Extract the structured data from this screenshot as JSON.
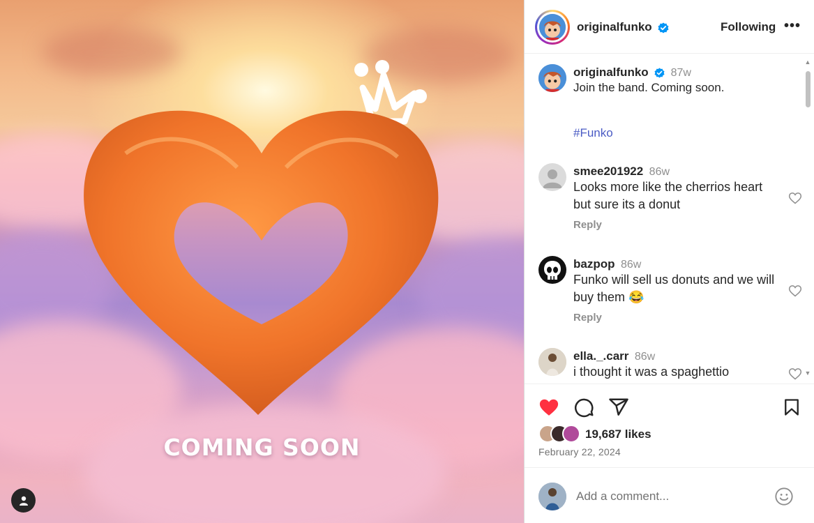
{
  "media": {
    "overlay_text": "COMING SOON",
    "tag_icon": "person-icon"
  },
  "header": {
    "username": "originalfunko",
    "verified_icon": "verified-badge-icon",
    "follow_state": "Following",
    "more_label": "•••"
  },
  "caption": {
    "username": "originalfunko",
    "time": "87w",
    "text": "Join the band. Coming soon.",
    "hashtag": "#Funko"
  },
  "comments": [
    {
      "username": "smee201922",
      "time": "86w",
      "text": "Looks more like the cherrios heart but sure its a donut",
      "reply_label": "Reply"
    },
    {
      "username": "bazpop",
      "time": "86w",
      "text": "Funko will sell us donuts and we will buy them 😂",
      "reply_label": "Reply"
    },
    {
      "username": "ella._.carr",
      "time": "86w",
      "text": "i thought it was a spaghettio"
    }
  ],
  "actions": {
    "liked": true,
    "like_color": "#ff3040",
    "likes_text": "19,687 likes",
    "date": "February 22, 2024"
  },
  "add_comment": {
    "placeholder": "Add a comment..."
  }
}
